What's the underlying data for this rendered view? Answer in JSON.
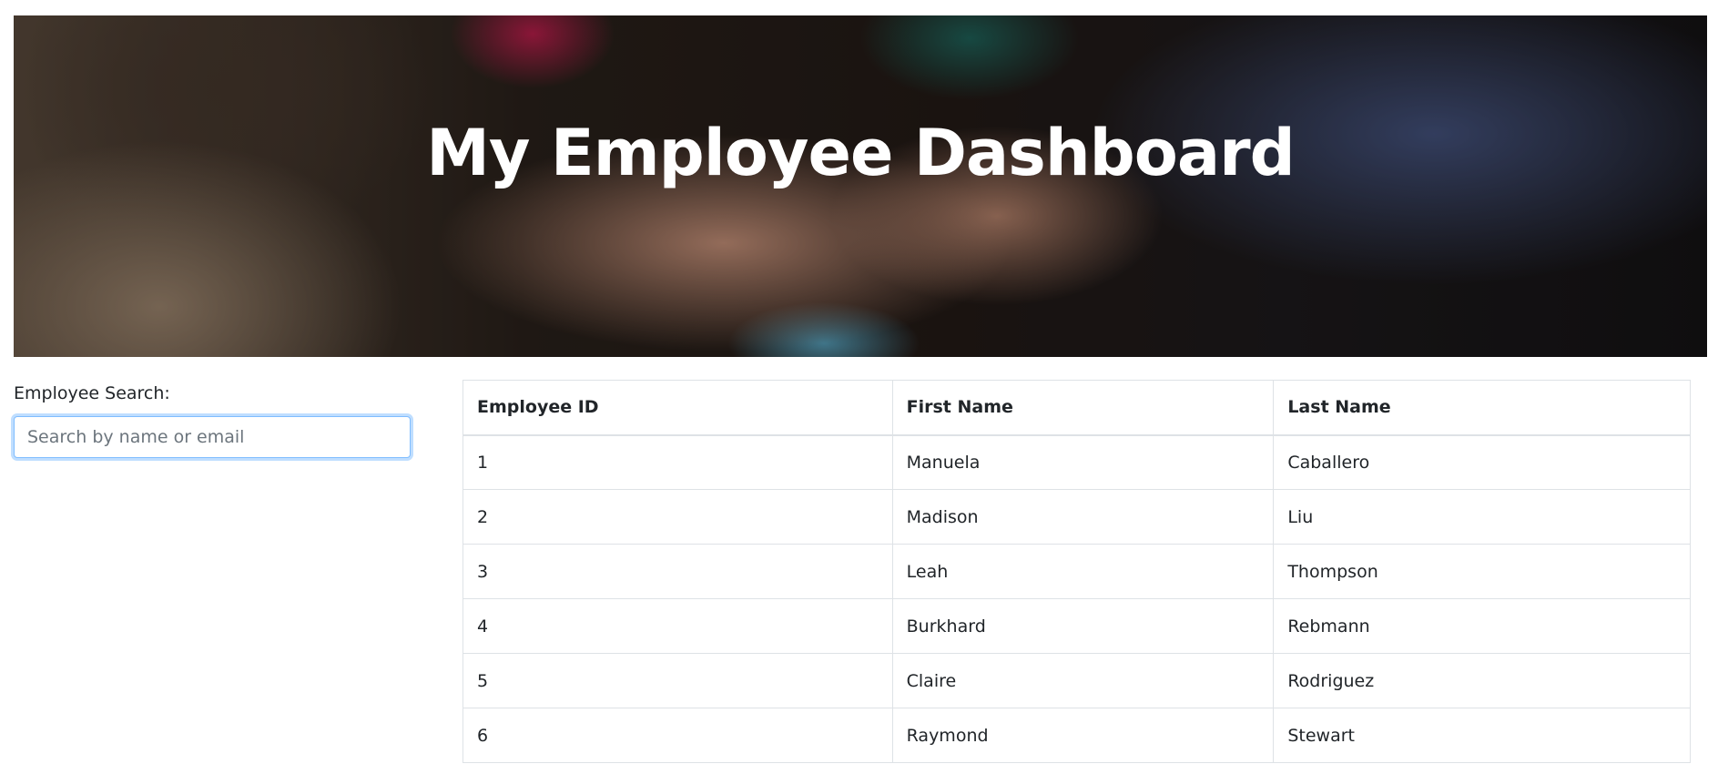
{
  "header": {
    "title": "My Employee Dashboard"
  },
  "search": {
    "label": "Employee Search:",
    "placeholder": "Search by name or email",
    "value": ""
  },
  "table": {
    "columns": [
      "Employee ID",
      "First Name",
      "Last Name"
    ],
    "rows": [
      [
        "1",
        "Manuela",
        "Caballero"
      ],
      [
        "2",
        "Madison",
        "Liu"
      ],
      [
        "3",
        "Leah",
        "Thompson"
      ],
      [
        "4",
        "Burkhard",
        "Rebmann"
      ],
      [
        "5",
        "Claire",
        "Rodriguez"
      ],
      [
        "6",
        "Raymond",
        "Stewart"
      ]
    ]
  }
}
